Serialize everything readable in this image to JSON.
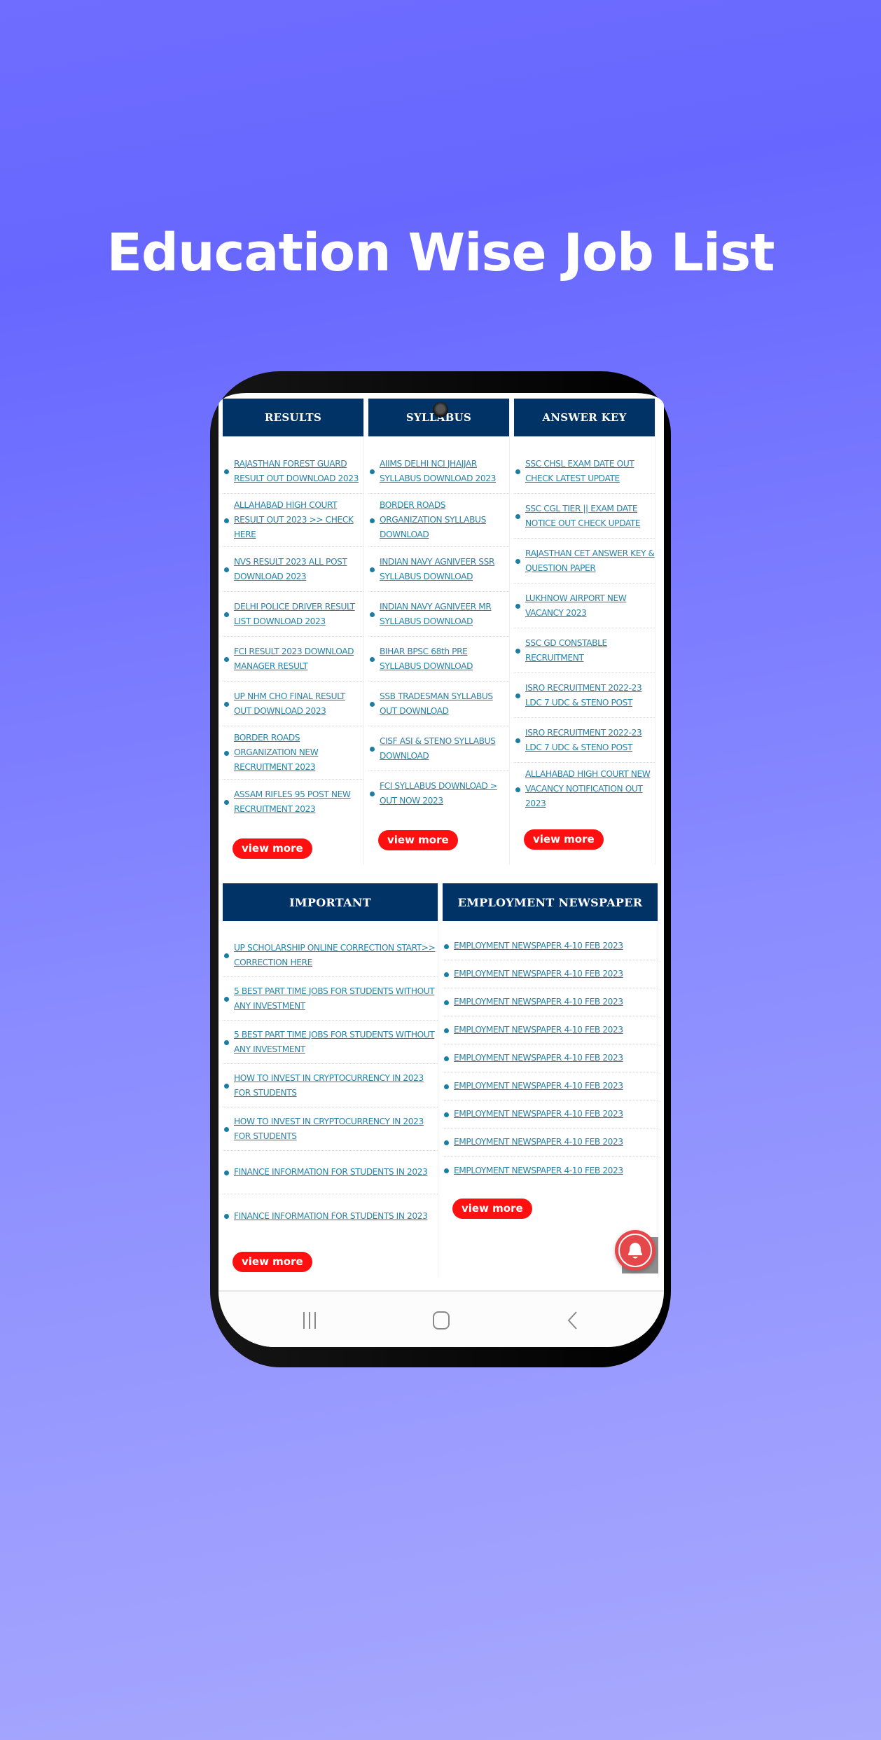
{
  "headline": "Education Wise Job List",
  "colors": {
    "header_bg": "#013366",
    "link": "#2a83a8",
    "view_more_bg": "#ff1010",
    "bell_fab": "#e5474b",
    "background_top": "#6767ff",
    "background_bottom": "#a9a9fd"
  },
  "sections": {
    "results": {
      "title": "RESULTS",
      "items": [
        "RAJASTHAN FOREST GUARD RESULT OUT DOWNLOAD 2023",
        "ALLAHABAD HIGH COURT RESULT OUT 2023 >> CHECK HERE",
        "NVS RESULT 2023 ALL POST DOWNLOAD 2023",
        "DELHI POLICE DRIVER RESULT LIST DOWNLOAD 2023",
        "FCI RESULT 2023 DOWNLOAD MANAGER RESULT",
        "UP NHM CHO FINAL RESULT OUT DOWNLOAD 2023",
        "BORDER ROADS ORGANIZATION NEW RECRUITMENT 2023",
        "ASSAM RIFLES 95 POST NEW RECRUITMENT 2023"
      ],
      "view_more": "view more"
    },
    "syllabus": {
      "title": "SYLLABUS",
      "items": [
        "AIIMS DELHI NCI JHAJJAR SYLLABUS DOWNLOAD 2023",
        "BORDER ROADS ORGANIZATION SYLLABUS DOWNLOAD",
        "INDIAN NAVY AGNIVEER SSR SYLLABUS DOWNLOAD",
        "INDIAN NAVY AGNIVEER MR SYLLABUS DOWNLOAD",
        "BIHAR BPSC 68th PRE SYLLABUS DOWNLOAD",
        "SSB TRADESMAN SYLLABUS OUT DOWNLOAD",
        "CISF ASI & STENO SYLLABUS DOWNLOAD",
        "FCI SYLLABUS DOWNLOAD > OUT NOW 2023"
      ],
      "view_more": "view more"
    },
    "answer_key": {
      "title": "ANSWER KEY",
      "items": [
        "SSC CHSL EXAM DATE OUT CHECK LATEST UPDATE",
        "SSC CGL TIER || EXAM DATE NOTICE OUT CHECK UPDATE",
        "RAJASTHAN CET ANSWER KEY & QUESTION PAPER",
        "LUKHNOW AIRPORT NEW VACANCY 2023",
        "SSC GD CONSTABLE RECRUITMENT",
        "ISRO RECRUITMENT 2022-23 LDC 7 UDC & STENO POST",
        "ISRO RECRUITMENT 2022-23 LDC 7 UDC & STENO POST",
        "ALLAHABAD HIGH COURT NEW VACANCY NOTIFICATION OUT 2023"
      ],
      "view_more": "view more"
    },
    "important": {
      "title": "IMPORTANT",
      "items": [
        "UP SCHOLARSHIP ONLINE CORRECTION START>> CORRECTION HERE",
        "5 BEST PART TIME JOBS FOR STUDENTS WITHOUT ANY INVESTMENT",
        "5 BEST PART TIME JOBS FOR STUDENTS WITHOUT ANY INVESTMENT",
        "HOW TO INVEST IN CRYPTOCURRENCY IN 2023 FOR STUDENTS",
        "HOW TO INVEST IN CRYPTOCURRENCY IN 2023 FOR STUDENTS",
        "FINANCE INFORMATION FOR STUDENTS IN 2023",
        "FINANCE INFORMATION FOR STUDENTS IN 2023"
      ],
      "view_more": "view more"
    },
    "employment_newspaper": {
      "title": "EMPLOYMENT NEWSPAPER",
      "items": [
        "EMPLOYMENT NEWSPAPER 4-10 FEB 2023",
        "EMPLOYMENT NEWSPAPER 4-10 FEB 2023",
        "EMPLOYMENT NEWSPAPER 4-10 FEB 2023",
        "EMPLOYMENT NEWSPAPER 4-10 FEB 2023",
        "EMPLOYMENT NEWSPAPER 4-10 FEB 2023",
        "EMPLOYMENT NEWSPAPER 4-10 FEB 2023",
        "EMPLOYMENT NEWSPAPER 4-10 FEB 2023",
        "EMPLOYMENT NEWSPAPER 4-10 FEB 2023",
        "EMPLOYMENT NEWSPAPER 4-10 FEB 2023"
      ],
      "view_more": "view more"
    }
  },
  "icons": {
    "notification": "bell-icon",
    "nav_recents": "recents-icon",
    "nav_home": "home-icon",
    "nav_back": "back-icon"
  }
}
